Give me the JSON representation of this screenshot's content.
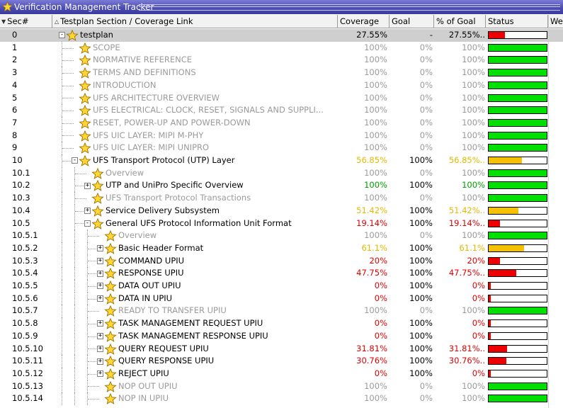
{
  "window": {
    "title": "Verification Management Tracker"
  },
  "header": {
    "sec": "Sec#",
    "section": "Testplan Section / Coverage Link",
    "coverage": "Coverage",
    "goal": "Goal",
    "pog": "% of Goal",
    "status": "Status",
    "weight": "We"
  },
  "colors": {
    "green": "#00e000",
    "yellow": "#f5c000",
    "red": "#ee0000",
    "selected": "#cfcfcf"
  },
  "rows": [
    {
      "sec": "0",
      "label": "testplan",
      "level": 0,
      "expander": "minus",
      "coverage": "27.55%",
      "goal": "-",
      "pog": "27.55%..",
      "fill": 0.2755,
      "tone": "blk",
      "labelTone": "blk",
      "selected": true
    },
    {
      "sec": "1",
      "label": "SCOPE",
      "level": 1,
      "expander": "",
      "coverage": "100%",
      "goal": "0%",
      "pog": "100%",
      "fill": 1,
      "tone": "gray",
      "labelTone": "gray"
    },
    {
      "sec": "2",
      "label": "NORMATIVE REFERENCE",
      "level": 1,
      "expander": "",
      "coverage": "100%",
      "goal": "0%",
      "pog": "100%",
      "fill": 1,
      "tone": "gray",
      "labelTone": "gray"
    },
    {
      "sec": "3",
      "label": "TERMS AND DEFINITIONS",
      "level": 1,
      "expander": "",
      "coverage": "100%",
      "goal": "0%",
      "pog": "100%",
      "fill": 1,
      "tone": "gray",
      "labelTone": "gray"
    },
    {
      "sec": "4",
      "label": "INTRODUCTION",
      "level": 1,
      "expander": "",
      "coverage": "100%",
      "goal": "0%",
      "pog": "100%",
      "fill": 1,
      "tone": "gray",
      "labelTone": "gray"
    },
    {
      "sec": "5",
      "label": "UFS ARCHITECTURE OVERVIEW",
      "level": 1,
      "expander": "",
      "coverage": "100%",
      "goal": "0%",
      "pog": "100%",
      "fill": 1,
      "tone": "gray",
      "labelTone": "gray"
    },
    {
      "sec": "6",
      "label": "UFS ELECTRICAL: CLOCK, RESET, SIGNALS AND SUPPLI...",
      "level": 1,
      "expander": "",
      "coverage": "100%",
      "goal": "0%",
      "pog": "100%",
      "fill": 1,
      "tone": "gray",
      "labelTone": "gray"
    },
    {
      "sec": "7",
      "label": "RESET, POWER-UP AND POWER-DOWN",
      "level": 1,
      "expander": "",
      "coverage": "100%",
      "goal": "0%",
      "pog": "100%",
      "fill": 1,
      "tone": "gray",
      "labelTone": "gray"
    },
    {
      "sec": "8",
      "label": "UFS UIC LAYER: MIPI M-PHY",
      "level": 1,
      "expander": "",
      "coverage": "100%",
      "goal": "0%",
      "pog": "100%",
      "fill": 1,
      "tone": "gray",
      "labelTone": "gray"
    },
    {
      "sec": "9",
      "label": "UFS UIC LAYER: MIPI UNIPRO",
      "level": 1,
      "expander": "",
      "coverage": "100%",
      "goal": "0%",
      "pog": "100%",
      "fill": 1,
      "tone": "gray",
      "labelTone": "gray"
    },
    {
      "sec": "10",
      "label": "UFS Transport Protocol (UTP) Layer",
      "level": 1,
      "expander": "minus",
      "coverage": "56.85%",
      "goal": "100%",
      "pog": "56.85%..",
      "fill": 0.5685,
      "tone": "orange",
      "labelTone": "blk"
    },
    {
      "sec": "10.1",
      "label": "Overview",
      "level": 2,
      "expander": "",
      "coverage": "100%",
      "goal": "0%",
      "pog": "100%",
      "fill": 1,
      "tone": "gray",
      "labelTone": "gray"
    },
    {
      "sec": "10.2",
      "label": "UTP and UniPro Specific Overview",
      "level": 2,
      "expander": "plus",
      "coverage": "100%",
      "goal": "100%",
      "pog": "100%",
      "fill": 1,
      "tone": "green",
      "labelTone": "blk"
    },
    {
      "sec": "10.3",
      "label": "UFS Transport Protocol Transactions",
      "level": 2,
      "expander": "",
      "coverage": "100%",
      "goal": "0%",
      "pog": "100%",
      "fill": 1,
      "tone": "gray",
      "labelTone": "gray"
    },
    {
      "sec": "10.4",
      "label": "Service Delivery Subsystem",
      "level": 2,
      "expander": "plus",
      "coverage": "51.42%",
      "goal": "100%",
      "pog": "51.42%..",
      "fill": 0.5142,
      "tone": "orange",
      "labelTone": "blk"
    },
    {
      "sec": "10.5",
      "label": "General UFS Protocol Information Unit Format",
      "level": 2,
      "expander": "minus",
      "coverage": "19.14%",
      "goal": "100%",
      "pog": "19.14%..",
      "fill": 0.1914,
      "tone": "red",
      "labelTone": "blk"
    },
    {
      "sec": "10.5.1",
      "label": "Overview",
      "level": 3,
      "expander": "",
      "coverage": "100%",
      "goal": "0%",
      "pog": "100%",
      "fill": 1,
      "tone": "gray",
      "labelTone": "gray"
    },
    {
      "sec": "10.5.2",
      "label": "Basic Header Format",
      "level": 3,
      "expander": "plus",
      "coverage": "61.1%",
      "goal": "100%",
      "pog": "61.1%",
      "fill": 0.611,
      "tone": "orange",
      "labelTone": "blk"
    },
    {
      "sec": "10.5.3",
      "label": "COMMAND UPIU",
      "level": 3,
      "expander": "plus",
      "coverage": "20%",
      "goal": "100%",
      "pog": "20%",
      "fill": 0.2,
      "tone": "red",
      "labelTone": "blk"
    },
    {
      "sec": "10.5.4",
      "label": "RESPONSE UPIU",
      "level": 3,
      "expander": "plus",
      "coverage": "47.75%",
      "goal": "100%",
      "pog": "47.75%..",
      "fill": 0.4775,
      "tone": "red",
      "labelTone": "blk"
    },
    {
      "sec": "10.5.5",
      "label": "DATA OUT UPIU",
      "level": 3,
      "expander": "plus",
      "coverage": "0%",
      "goal": "100%",
      "pog": "0%",
      "fill": 0,
      "tone": "red",
      "labelTone": "blk"
    },
    {
      "sec": "10.5.6",
      "label": "DATA IN UPIU",
      "level": 3,
      "expander": "plus",
      "coverage": "0%",
      "goal": "100%",
      "pog": "0%",
      "fill": 0,
      "tone": "red",
      "labelTone": "blk"
    },
    {
      "sec": "10.5.7",
      "label": "READY TO TRANSFER UPIU",
      "level": 3,
      "expander": "",
      "coverage": "100%",
      "goal": "0%",
      "pog": "100%",
      "fill": 1,
      "tone": "gray",
      "labelTone": "gray"
    },
    {
      "sec": "10.5.8",
      "label": "TASK MANAGEMENT REQUEST UPIU",
      "level": 3,
      "expander": "plus",
      "coverage": "0%",
      "goal": "100%",
      "pog": "0%",
      "fill": 0,
      "tone": "red",
      "labelTone": "blk"
    },
    {
      "sec": "10.5.9",
      "label": "TASK MANAGEMENT RESPONSE UPIU",
      "level": 3,
      "expander": "plus",
      "coverage": "0%",
      "goal": "100%",
      "pog": "0%",
      "fill": 0,
      "tone": "red",
      "labelTone": "blk"
    },
    {
      "sec": "10.5.10",
      "label": "QUERY REQUEST UPIU",
      "level": 3,
      "expander": "plus",
      "coverage": "31.81%",
      "goal": "100%",
      "pog": "31.81%..",
      "fill": 0.3181,
      "tone": "red",
      "labelTone": "blk"
    },
    {
      "sec": "10.5.11",
      "label": "QUERY RESPONSE UPIU",
      "level": 3,
      "expander": "plus",
      "coverage": "30.76%",
      "goal": "100%",
      "pog": "30.76%..",
      "fill": 0.3076,
      "tone": "red",
      "labelTone": "blk"
    },
    {
      "sec": "10.5.12",
      "label": "REJECT UPIU",
      "level": 3,
      "expander": "plus",
      "coverage": "0%",
      "goal": "100%",
      "pog": "0%",
      "fill": 0,
      "tone": "red",
      "labelTone": "blk"
    },
    {
      "sec": "10.5.13",
      "label": "NOP OUT UPIU",
      "level": 3,
      "expander": "",
      "coverage": "100%",
      "goal": "0%",
      "pog": "100%",
      "fill": 1,
      "tone": "gray",
      "labelTone": "gray"
    },
    {
      "sec": "10.5.14",
      "label": "NOP IN UPIU",
      "level": 3,
      "expander": "",
      "coverage": "100%",
      "goal": "0%",
      "pog": "100%",
      "fill": 1,
      "tone": "gray",
      "labelTone": "gray"
    }
  ]
}
